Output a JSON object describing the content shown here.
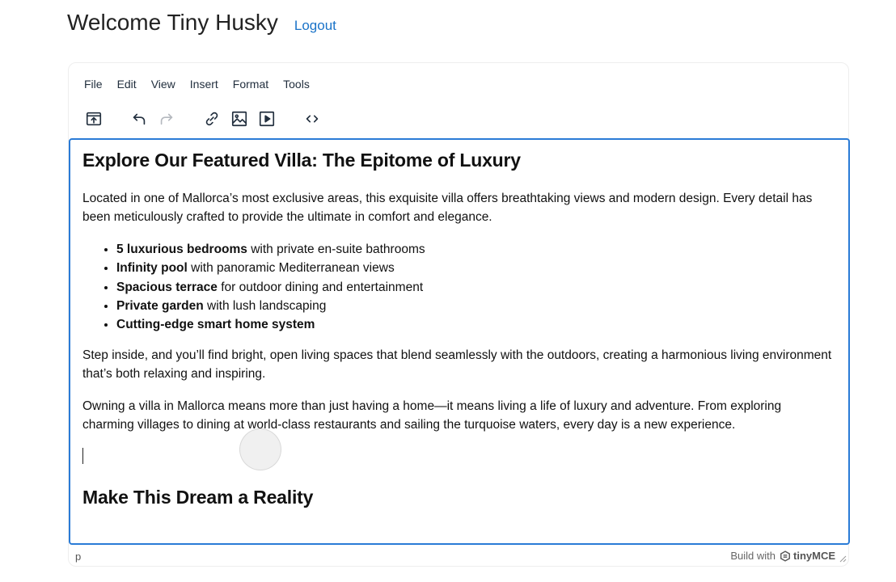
{
  "header": {
    "welcome": "Welcome Tiny Husky",
    "logout": "Logout"
  },
  "menubar": {
    "items": [
      "File",
      "Edit",
      "View",
      "Insert",
      "Format",
      "Tools"
    ]
  },
  "toolbar": {
    "buttons": [
      "upload-icon",
      "undo-icon",
      "redo-icon",
      "link-icon",
      "image-icon",
      "media-icon",
      "code-icon"
    ]
  },
  "content": {
    "heading1": "Explore Our Featured Villa: The Epitome of Luxury",
    "para1": "Located in one of Mallorca’s most exclusive areas, this exquisite villa offers breathtaking views and modern design. Every detail has been meticulously crafted to provide the ultimate in comfort and elegance.",
    "features": [
      {
        "bold": "5 luxurious bedrooms",
        "rest": " with private en-suite bathrooms"
      },
      {
        "bold": "Infinity pool",
        "rest": " with panoramic Mediterranean views"
      },
      {
        "bold": "Spacious terrace",
        "rest": " for outdoor dining and entertainment"
      },
      {
        "bold": "Private garden",
        "rest": " with lush landscaping"
      },
      {
        "bold": "Cutting-edge smart home system",
        "rest": ""
      }
    ],
    "para2": "Step inside, and you’ll find bright, open living spaces that blend seamlessly with the outdoors, creating a harmonious living environment that’s both relaxing and inspiring.",
    "para3": "Owning a villa in Mallorca means more than just having a home—it means living a life of luxury and adventure. From exploring charming villages to dining at world-class restaurants and sailing the turquoise waters, every day is a new experience.",
    "heading2": "Make This Dream a Reality"
  },
  "statusbar": {
    "path": "p",
    "build_with": "Build with",
    "brand": "tinyMCE"
  },
  "colors": {
    "accent": "#2a7bd6",
    "link": "#1a73c8"
  }
}
